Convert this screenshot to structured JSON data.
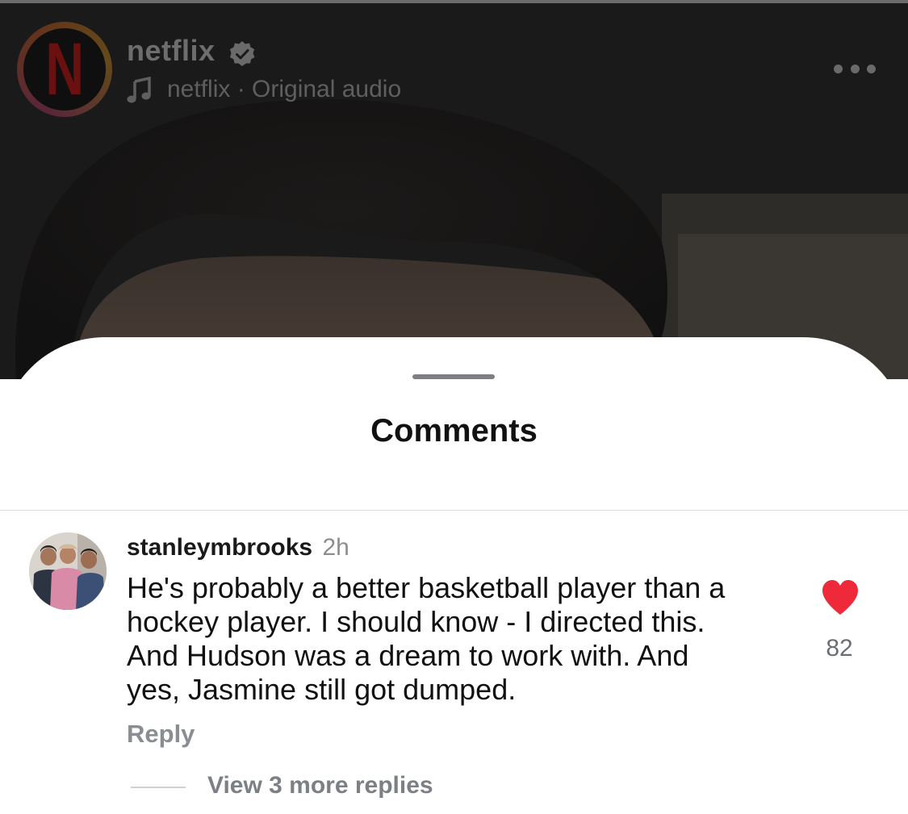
{
  "video": {
    "account": "netflix",
    "logo_letter": "N",
    "audio_label": "netflix · Original audio"
  },
  "sheet": {
    "title": "Comments"
  },
  "comment": {
    "username": "stanleymbrooks",
    "time": "2h",
    "lines": [
      "He's probably a better basketball player than a",
      "hockey player. I should know - I directed this.",
      "And Hudson was a dream to work with.  And",
      "yes, Jasmine still got dumped."
    ],
    "like_count": "82",
    "reply_label": "Reply",
    "view_replies_label": "View 3 more replies"
  },
  "colors": {
    "heart": "#ee2a3a",
    "verified_badge": "#6a6a6a",
    "netflix_red": "#6a1010"
  },
  "icons": [
    "verified-badge-icon",
    "music-note-icon",
    "more-options-icon",
    "heart-icon"
  ]
}
